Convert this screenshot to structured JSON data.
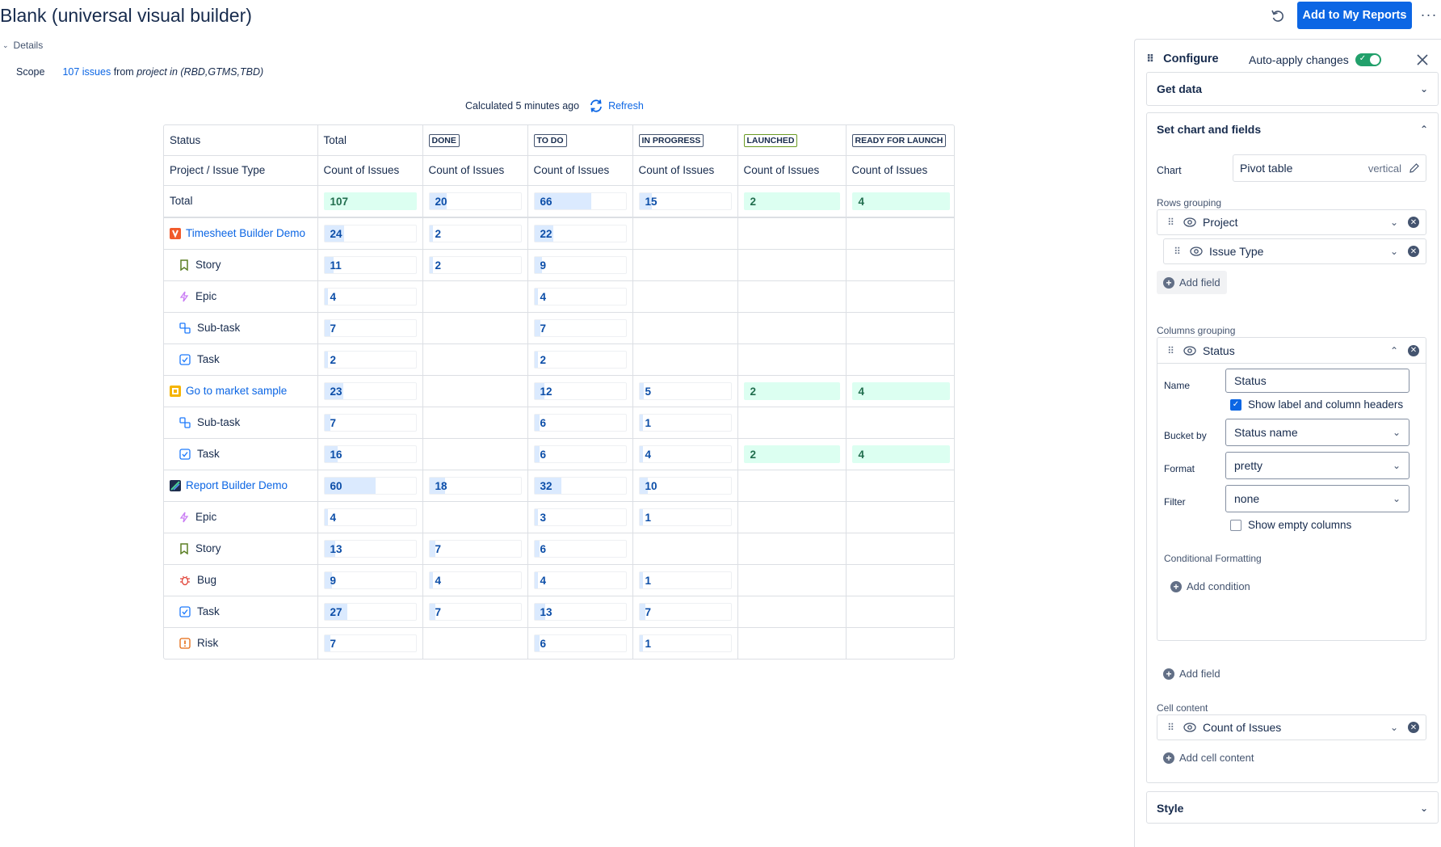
{
  "page": {
    "title": "Blank (universal visual builder)",
    "add_button": "Add to My Reports",
    "more": "···",
    "details_label": "Details",
    "scope_label": "Scope",
    "scope_link": "107 issues",
    "scope_from": "from",
    "scope_query": "project in (RBD,GTMS,TBD)",
    "calculated": "Calculated 5 minutes ago",
    "refresh": "Refresh"
  },
  "table": {
    "header_row1": {
      "label": "Status",
      "total": "Total",
      "statuses": [
        "DONE",
        "TO DO",
        "IN PROGRESS",
        "LAUNCHED",
        "READY FOR LAUNCH"
      ]
    },
    "header_row2": {
      "label": "Project / Issue Type",
      "measure": "Count of Issues"
    },
    "total_row": {
      "label": "Total",
      "values": [
        107,
        20,
        66,
        15,
        2,
        4
      ]
    },
    "rows": [
      {
        "kind": "project",
        "icon": "timesheet-project-icon",
        "label": "Timesheet Builder Demo",
        "values": [
          24,
          2,
          22,
          null,
          null,
          null
        ]
      },
      {
        "kind": "type",
        "icon": "story-icon",
        "label": "Story",
        "values": [
          11,
          2,
          9,
          null,
          null,
          null
        ]
      },
      {
        "kind": "type",
        "icon": "epic-icon",
        "label": "Epic",
        "values": [
          4,
          null,
          4,
          null,
          null,
          null
        ]
      },
      {
        "kind": "type",
        "icon": "subtask-icon",
        "label": "Sub-task",
        "values": [
          7,
          null,
          7,
          null,
          null,
          null
        ]
      },
      {
        "kind": "type",
        "icon": "task-icon",
        "label": "Task",
        "values": [
          2,
          null,
          2,
          null,
          null,
          null
        ]
      },
      {
        "kind": "project",
        "icon": "gtm-project-icon",
        "label": "Go to market sample",
        "values": [
          23,
          null,
          12,
          5,
          2,
          4
        ]
      },
      {
        "kind": "type",
        "icon": "subtask-icon",
        "label": "Sub-task",
        "values": [
          7,
          null,
          6,
          1,
          null,
          null
        ]
      },
      {
        "kind": "type",
        "icon": "task-icon",
        "label": "Task",
        "values": [
          16,
          null,
          6,
          4,
          2,
          4
        ]
      },
      {
        "kind": "project",
        "icon": "report-project-icon",
        "label": "Report Builder Demo",
        "values": [
          60,
          18,
          32,
          10,
          null,
          null
        ]
      },
      {
        "kind": "type",
        "icon": "epic-icon",
        "label": "Epic",
        "values": [
          4,
          null,
          3,
          1,
          null,
          null
        ]
      },
      {
        "kind": "type",
        "icon": "story-icon",
        "label": "Story",
        "values": [
          13,
          7,
          6,
          null,
          null,
          null
        ]
      },
      {
        "kind": "type",
        "icon": "bug-icon",
        "label": "Bug",
        "values": [
          9,
          4,
          4,
          1,
          null,
          null
        ]
      },
      {
        "kind": "type",
        "icon": "task-icon",
        "label": "Task",
        "values": [
          27,
          7,
          13,
          7,
          null,
          null
        ]
      },
      {
        "kind": "type",
        "icon": "risk-icon",
        "label": "Risk",
        "values": [
          7,
          null,
          6,
          1,
          null,
          null
        ]
      }
    ],
    "green_columns": [
      4,
      5
    ],
    "bar_max": 107
  },
  "panel": {
    "title": "Configure",
    "auto_apply": "Auto-apply changes",
    "get_data": "Get data",
    "set_chart": "Set chart and fields",
    "chart_label": "Chart",
    "chart_value": "Pivot table",
    "chart_orientation": "vertical",
    "rows_grouping": "Rows grouping",
    "row_fields": [
      "Project",
      "Issue Type"
    ],
    "add_field": "Add field",
    "columns_grouping": "Columns grouping",
    "column_field": "Status",
    "name_label": "Name",
    "name_value": "Status",
    "show_label": "Show label and column headers",
    "bucket_label": "Bucket by",
    "bucket_value": "Status name",
    "format_label": "Format",
    "format_value": "pretty",
    "filter_label": "Filter",
    "filter_value": "none",
    "show_empty": "Show empty columns",
    "cond_formatting": "Conditional Formatting",
    "add_condition": "Add condition",
    "cell_content": "Cell content",
    "cell_field": "Count of Issues",
    "add_cell_content": "Add cell content",
    "style": "Style"
  },
  "colors": {
    "primary": "#0c66e4",
    "bar_blue": "#dbeafe",
    "bar_green": "#dcfff1",
    "toggle_on": "#22a06b"
  }
}
